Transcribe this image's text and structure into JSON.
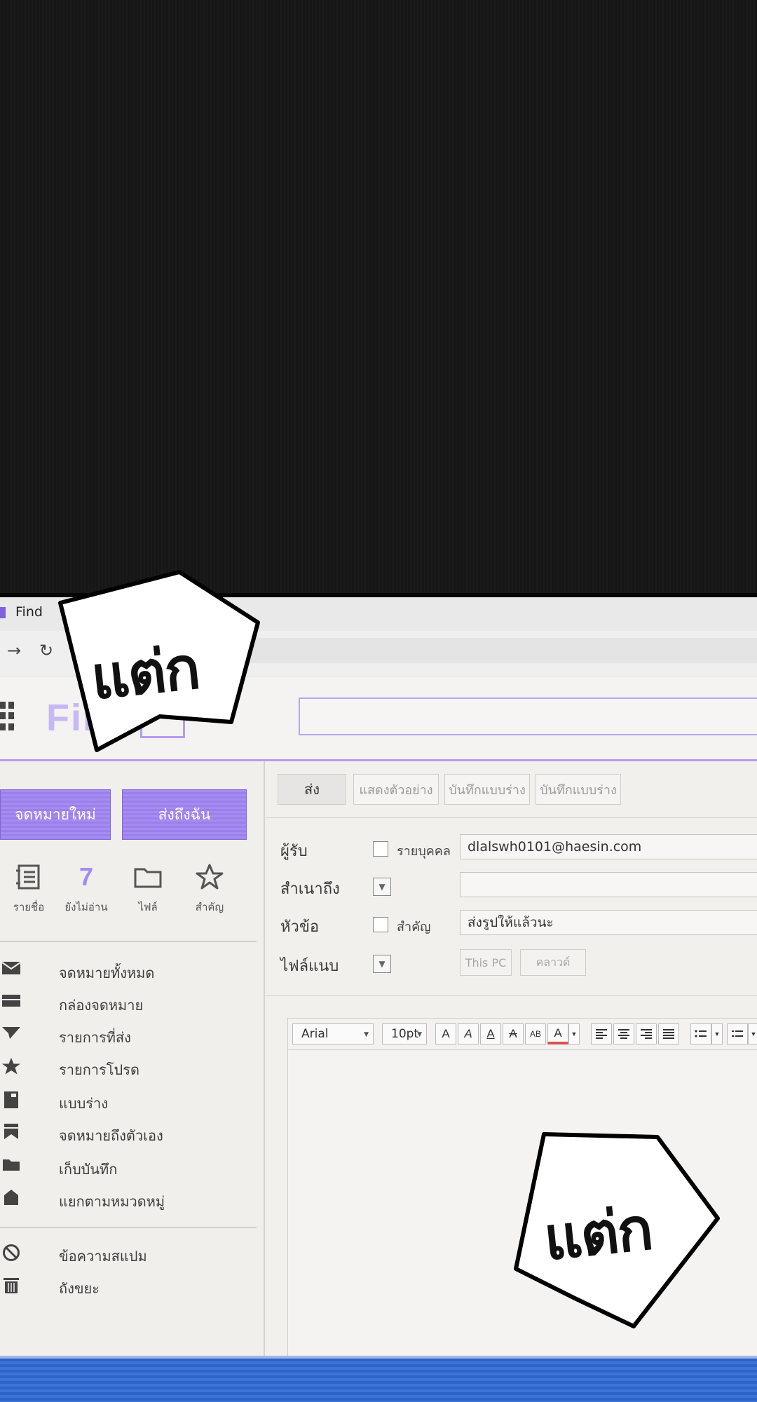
{
  "browser": {
    "tab_title": "Find",
    "back_icon": "arrow-right-icon",
    "reload_icon": "reload-icon"
  },
  "app": {
    "logo_text": "Find"
  },
  "sidebar": {
    "new_mail_label": "จดหมายใหม่",
    "send_to_me_label": "ส่งถึงฉัน",
    "quick": [
      {
        "label": "รายชื่อ",
        "icon": "contacts-icon"
      },
      {
        "value": "7",
        "label": "ยังไม่อ่าน"
      },
      {
        "label": "ไฟล์",
        "icon": "folder-icon"
      },
      {
        "label": "สำคัญ",
        "icon": "star-icon"
      }
    ],
    "items": [
      {
        "label": "จดหมายทั้งหมด",
        "icon": "envelope-icon"
      },
      {
        "label": "กล่องจดหมาย",
        "icon": "inbox-icon"
      },
      {
        "label": "รายการที่ส่ง",
        "icon": "send-icon"
      },
      {
        "label": "รายการโปรด",
        "icon": "star-filled-icon"
      },
      {
        "label": "แบบร่าง",
        "icon": "draft-icon"
      },
      {
        "label": "จดหมายถึงตัวเอง",
        "icon": "bookmark-icon"
      },
      {
        "label": "เก็บบันทึก",
        "icon": "folder-filled-icon"
      },
      {
        "label": "แยกตามหมวดหมู่",
        "icon": "tag-icon"
      }
    ],
    "extra_items": [
      {
        "label": "ข้อความสแปม",
        "icon": "block-icon"
      },
      {
        "label": "ถังขยะ",
        "icon": "trash-icon"
      }
    ]
  },
  "compose": {
    "toolbar": {
      "send": "ส่ง",
      "preview": "แสดงตัวอย่าง",
      "save_draft_1": "บันทึกแบบร่าง",
      "save_draft_2": "บันทึกแบบร่าง"
    },
    "to_label": "ผู้รับ",
    "to_checkbox_label": "รายบุคคล",
    "to_value": "dlalswh0101@haesin.com",
    "cc_label": "สำเนาถึง",
    "subject_label": "หัวข้อ",
    "subject_checkbox_label": "สำคัญ",
    "subject_value": "ส่งรูปให้แล้วนะ",
    "attach_label": "ไฟล์แนบ",
    "attach_pc": "This PC",
    "attach_cloud": "คลาวด์"
  },
  "editor": {
    "font": "Arial",
    "size": "10pt",
    "format_buttons": [
      "A",
      "A",
      "A",
      "A",
      "AB",
      "A"
    ]
  },
  "sfx": {
    "top": "แต่ก",
    "bottom": "แต่ก"
  }
}
